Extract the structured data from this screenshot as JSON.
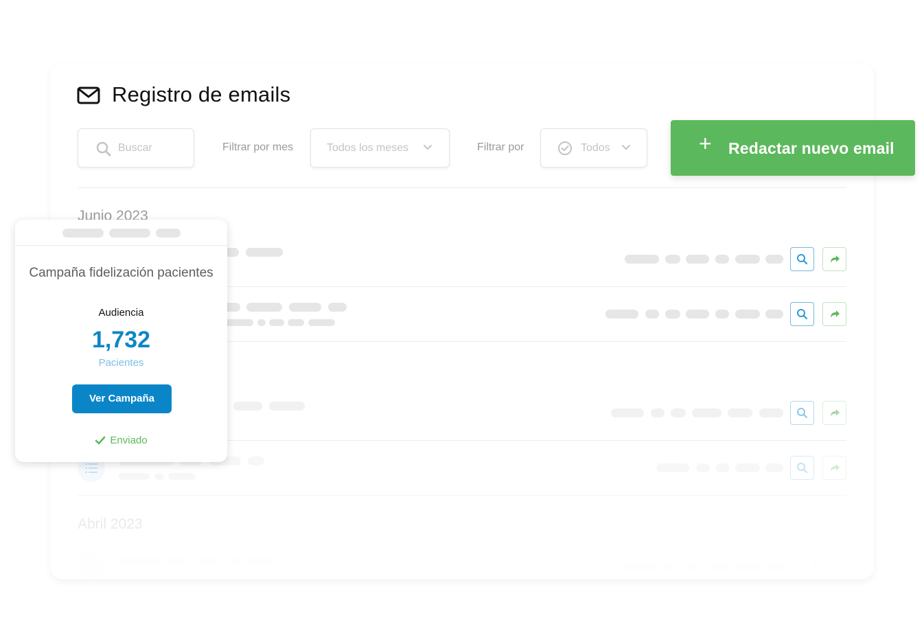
{
  "header": {
    "title": "Registro de emails",
    "icon": "envelope-icon"
  },
  "toolbar": {
    "search_placeholder": "Buscar",
    "month_filter_label": "Filtrar por mes",
    "month_filter_value": "Todos los meses",
    "status_filter_label": "Filtrar por",
    "status_filter_value": "Todos",
    "compose_label": "Redactar nuevo email",
    "compose_color": "#5cb85c"
  },
  "list": {
    "months": [
      "Junio 2023",
      "Abril 2023"
    ]
  },
  "campaign_popup": {
    "name": "Campaña fidelización pacientes",
    "audience_label": "Audiencia",
    "audience_count": "1,732",
    "audience_unit": "Pacientes",
    "view_button": "Ver Campaña",
    "status": "Enviado",
    "accent_color": "#0a86c8"
  }
}
